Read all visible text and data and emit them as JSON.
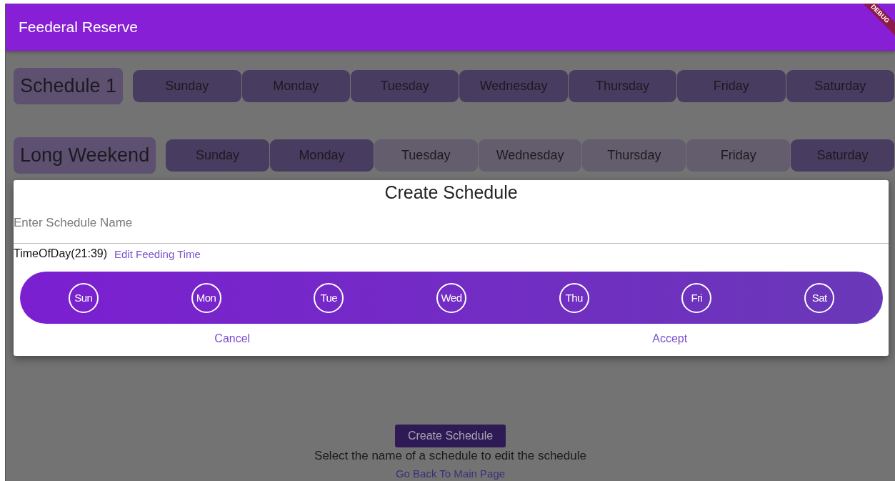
{
  "app_bar": {
    "title": "Feederal Reserve",
    "debug_banner": "DEBUG"
  },
  "schedules": [
    {
      "name": "Schedule 1",
      "days": [
        {
          "label": "Sunday",
          "selected": true
        },
        {
          "label": "Monday",
          "selected": true
        },
        {
          "label": "Tuesday",
          "selected": true
        },
        {
          "label": "Wednesday",
          "selected": true
        },
        {
          "label": "Thursday",
          "selected": true
        },
        {
          "label": "Friday",
          "selected": true
        },
        {
          "label": "Saturday",
          "selected": true
        }
      ]
    },
    {
      "name": "Long Weekend",
      "days": [
        {
          "label": "Sunday",
          "selected": true
        },
        {
          "label": "Monday",
          "selected": true
        },
        {
          "label": "Tuesday",
          "selected": false
        },
        {
          "label": "Wednesday",
          "selected": false
        },
        {
          "label": "Thursday",
          "selected": false
        },
        {
          "label": "Friday",
          "selected": false
        },
        {
          "label": "Saturday",
          "selected": true
        }
      ]
    }
  ],
  "create_button": "Create Schedule",
  "hint": "Select the name of a schedule to edit the schedule",
  "back_link": "Go Back To Main Page",
  "dialog": {
    "title": "Create Schedule",
    "name_field": {
      "placeholder": "Enter Schedule Name"
    },
    "time": "TimeOfDay(21:39)",
    "edit_time_link": "Edit Feeding Time",
    "days": [
      {
        "label": "Sun",
        "selected": false
      },
      {
        "label": "Mon",
        "selected": false
      },
      {
        "label": "Tue",
        "selected": false
      },
      {
        "label": "Wed",
        "selected": false
      },
      {
        "label": "Thu",
        "selected": false
      },
      {
        "label": "Fri",
        "selected": false
      },
      {
        "label": "Sat",
        "selected": false
      }
    ],
    "actions": [
      "Cancel",
      "Accept"
    ]
  }
}
